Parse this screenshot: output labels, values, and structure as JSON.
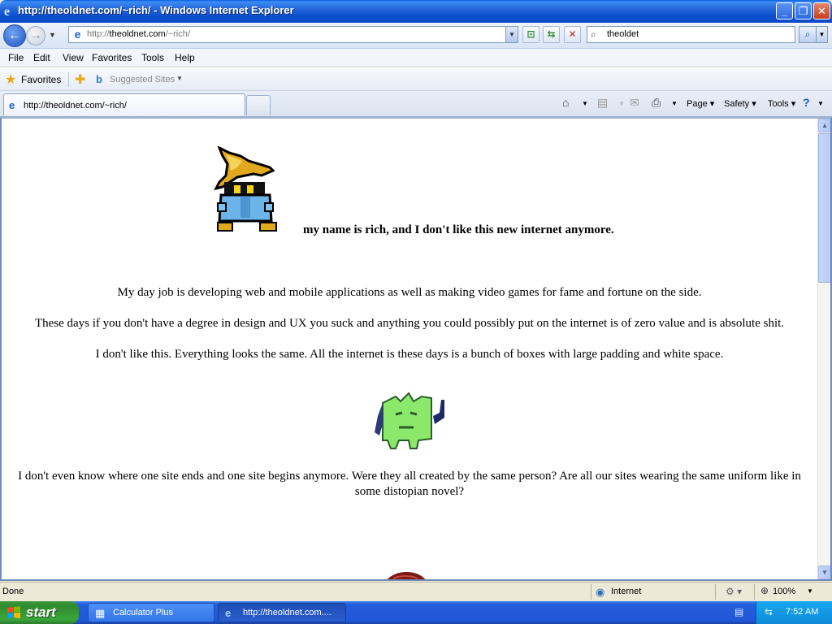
{
  "window": {
    "title": "http://theoldnet.com/~rich/ - Windows Internet Explorer"
  },
  "addressbar": {
    "url_prefix": "http://",
    "url_host": "theoldnet.com",
    "url_path": "/~rich/"
  },
  "search": {
    "value": "theoldet"
  },
  "menu": {
    "items": [
      "File",
      "Edit",
      "View",
      "Favorites",
      "Tools",
      "Help"
    ]
  },
  "favorites_bar": {
    "favorites_label": "Favorites",
    "suggested_label": "Suggested Sites"
  },
  "tabs": {
    "active_label": "http://theoldnet.com/~rich/"
  },
  "command_bar": {
    "page_label": "Page",
    "safety_label": "Safety",
    "tools_label": "Tools"
  },
  "page": {
    "headline": "my name is rich, and I don't like this new internet anymore.",
    "paragraphs": [
      "My day job is developing web and mobile applications as well as making video games for fame and fortune on the side.",
      "These days if you don't have a degree in design and UX you suck and anything you could possibly put on the internet is of zero value and is absolute shit.",
      "I don't like this. Everything looks the same. All the internet is these days is a bunch of boxes with large padding and white space.",
      "I don't even know where one site ends and one site begins anymore. Were they all created by the same person? Are all our sites wearing the same uniform like in some distopian novel?"
    ]
  },
  "status": {
    "text": "Done",
    "zone": "Internet",
    "zoom": "100%"
  },
  "taskbar": {
    "start_label": "start",
    "items": [
      "Calculator Plus",
      "http://theoldnet.com...."
    ],
    "clock": "7:52 AM"
  },
  "colors": {
    "titlebar_blue": "#0b49c4",
    "taskbar_blue": "#245edb",
    "start_green": "#3aa53a",
    "mage_hat": "#e0a81c",
    "mage_robe": "#6ab4ea",
    "blob_green": "#8be86a"
  }
}
